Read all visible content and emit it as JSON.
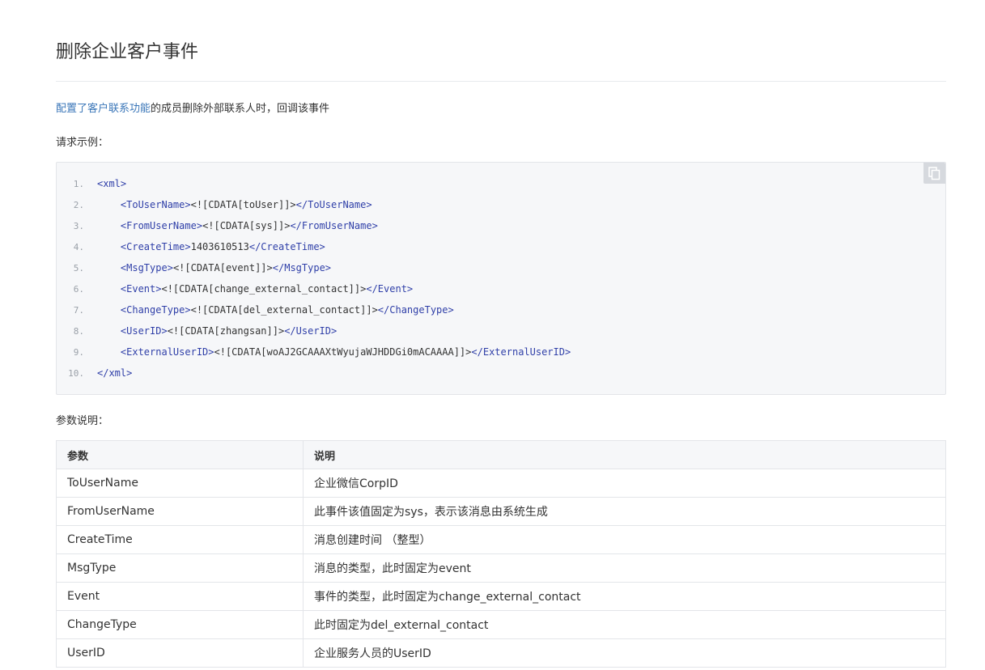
{
  "page": {
    "title": "删除企业客户事件",
    "intro_link": "配置了客户联系功能",
    "intro_rest": "的成员删除外部联系人时，回调该事件",
    "request_label": "请求示例：",
    "params_label": "参数说明："
  },
  "code": {
    "copy_icon": "copy-icon",
    "lines": [
      {
        "num": "1.",
        "indent": "",
        "open": "<xml>",
        "text": "",
        "close": ""
      },
      {
        "num": "2.",
        "indent": "    ",
        "open": "<ToUserName>",
        "text": "<![CDATA[toUser]]>",
        "close": "</ToUserName>"
      },
      {
        "num": "3.",
        "indent": "    ",
        "open": "<FromUserName>",
        "text": "<![CDATA[sys]]>",
        "close": "</FromUserName>"
      },
      {
        "num": "4.",
        "indent": "    ",
        "open": "<CreateTime>",
        "text": "1403610513",
        "close": "</CreateTime>"
      },
      {
        "num": "5.",
        "indent": "    ",
        "open": "<MsgType>",
        "text": "<![CDATA[event]]>",
        "close": "</MsgType>"
      },
      {
        "num": "6.",
        "indent": "    ",
        "open": "<Event>",
        "text": "<![CDATA[change_external_contact]]>",
        "close": "</Event>"
      },
      {
        "num": "7.",
        "indent": "    ",
        "open": "<ChangeType>",
        "text": "<![CDATA[del_external_contact]]>",
        "close": "</ChangeType>"
      },
      {
        "num": "8.",
        "indent": "    ",
        "open": "<UserID>",
        "text": "<![CDATA[zhangsan]]>",
        "close": "</UserID>"
      },
      {
        "num": "9.",
        "indent": "    ",
        "open": "<ExternalUserID>",
        "text": "<![CDATA[woAJ2GCAAAXtWyujaWJHDDGi0mACAAAA]]>",
        "close": "</ExternalUserID>"
      },
      {
        "num": "10.",
        "indent": "",
        "open": "</xml>",
        "text": "",
        "close": ""
      }
    ]
  },
  "table": {
    "headers": [
      "参数",
      "说明"
    ],
    "rows": [
      [
        "ToUserName",
        "企业微信CorpID"
      ],
      [
        "FromUserName",
        "此事件该值固定为sys，表示该消息由系统生成"
      ],
      [
        "CreateTime",
        "消息创建时间 （整型）"
      ],
      [
        "MsgType",
        "消息的类型，此时固定为event"
      ],
      [
        "Event",
        "事件的类型，此时固定为change_external_contact"
      ],
      [
        "ChangeType",
        "此时固定为del_external_contact"
      ],
      [
        "UserID",
        "企业服务人员的UserID"
      ]
    ]
  },
  "colors": {
    "link": "#3a76b8",
    "tag": "#2f3fa8",
    "code_bg": "#f6f7f9"
  }
}
